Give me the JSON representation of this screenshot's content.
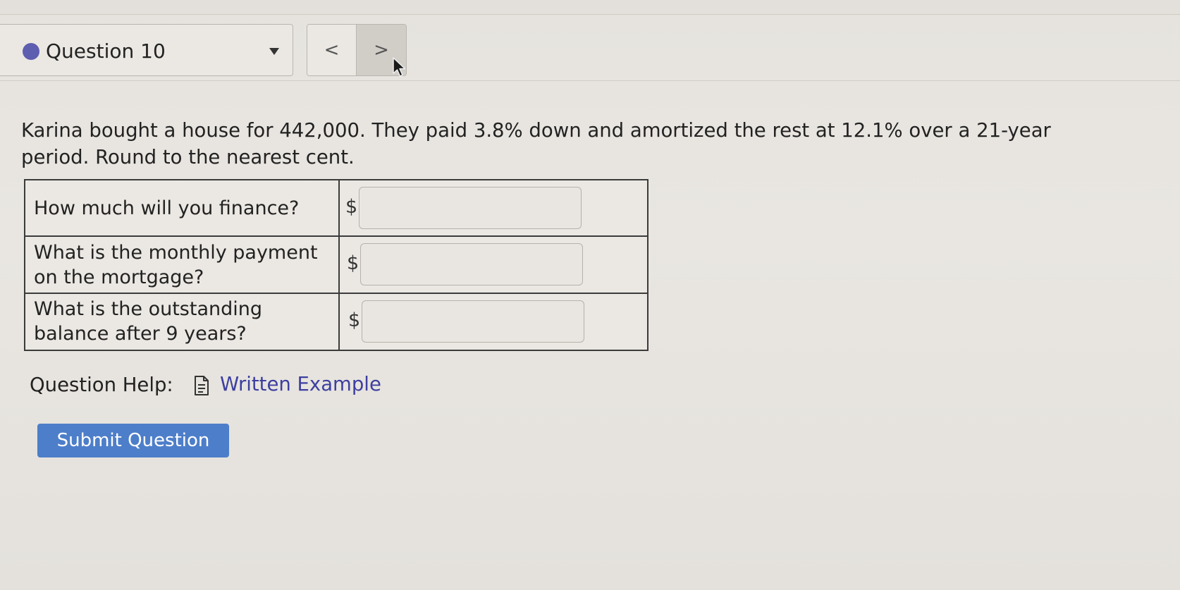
{
  "question_selector": {
    "label": "Question 10",
    "status_color": "#5d5eb0"
  },
  "nav": {
    "prev_glyph": "<",
    "next_glyph": ">"
  },
  "problem": {
    "line1": "Karina bought a house for 442,000. They paid 3.8% down and amortized the rest at 12.1% over a 21-year",
    "line2": "period.  Round to the nearest cent."
  },
  "table": {
    "rows": [
      {
        "question_line1": "How much will you finance?",
        "question_line2": "",
        "currency": "$",
        "value": ""
      },
      {
        "question_line1": "What is the monthly payment",
        "question_line2": "on the mortgage?",
        "currency": "$",
        "value": ""
      },
      {
        "question_line1": "What is the outstanding",
        "question_line2": "balance after 9 years?",
        "currency": "$",
        "value": ""
      }
    ]
  },
  "help": {
    "label": "Question Help:",
    "link_label": "Written Example",
    "icon": "document-icon"
  },
  "submit": {
    "label": "Submit Question",
    "color": "#4d7ec9"
  }
}
